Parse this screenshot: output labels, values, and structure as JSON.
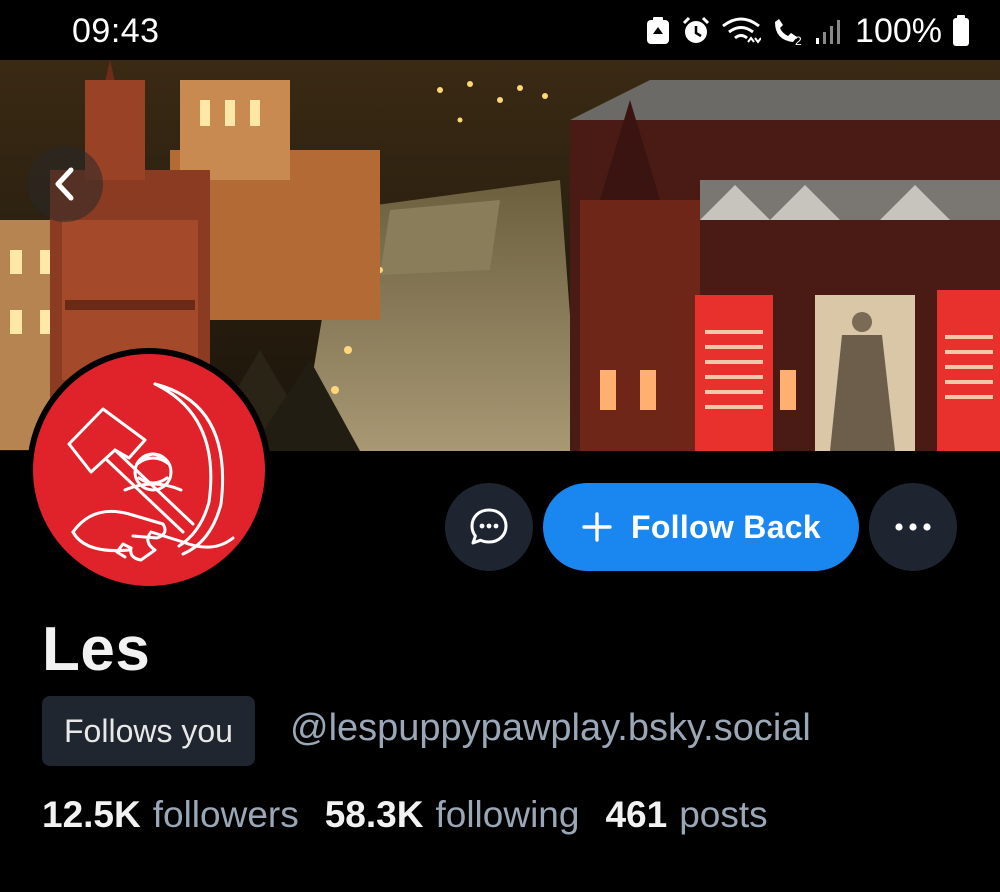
{
  "status_bar": {
    "time": "09:43",
    "battery": "100%",
    "icons": [
      "recycle-notification-icon",
      "alarm-icon",
      "wifi-icon",
      "wifi-calling-icon",
      "signal-icon",
      "battery-icon"
    ]
  },
  "banner": {
    "description_icon": "banner-image"
  },
  "header": {
    "back_icon": "chevron-left-icon"
  },
  "actions": {
    "message_icon": "chat-bubble-icon",
    "follow_label": "Follow Back",
    "follow_icon": "plus-icon",
    "more_icon": "ellipsis-icon"
  },
  "profile": {
    "display_name": "Les",
    "follows_you": "Follows you",
    "handle": "@lespuppypawplay.bsky.social"
  },
  "stats": {
    "followers_count": "12.5K",
    "followers_label": "followers",
    "following_count": "58.3K",
    "following_label": "following",
    "posts_count": "461",
    "posts_label": "posts"
  },
  "colors": {
    "follow_button": "#1a86f0",
    "avatar_bg": "#e0232a",
    "secondary_text": "#9aa7b6",
    "badge_bg": "#1f2630"
  }
}
